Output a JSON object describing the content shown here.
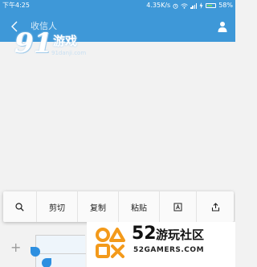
{
  "status_bar": {
    "time": "下午4:25",
    "speed": "4.35K/s",
    "battery": "58%"
  },
  "app_bar": {
    "title": "收信人"
  },
  "watermark_top": {
    "logo_number": "91",
    "logo_text": "游戏",
    "url": "91danji.com"
  },
  "context_menu": {
    "items": [
      {
        "id": "search",
        "label": "",
        "icon": "search-icon"
      },
      {
        "id": "cut",
        "label": "剪切"
      },
      {
        "id": "copy",
        "label": "复制"
      },
      {
        "id": "paste",
        "label": "粘贴"
      },
      {
        "id": "select_all",
        "label": "",
        "icon": "select-all-icon"
      },
      {
        "id": "share",
        "label": "",
        "icon": "share-icon"
      }
    ]
  },
  "compose": {
    "plus": "+"
  },
  "watermark_bottom": {
    "number": "52",
    "text": "游玩社区",
    "site": "52GAMERS.COM"
  },
  "colors": {
    "accent": "#3e98d8",
    "handle": "#2d8fe0",
    "logo_orange": "#f39a1b"
  }
}
